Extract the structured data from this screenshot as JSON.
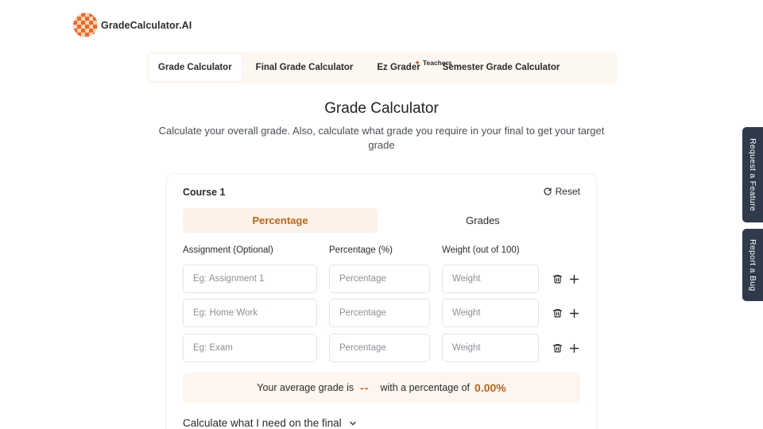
{
  "brand": {
    "name": "GradeCalculator.AI",
    "colors": {
      "accent": "#b8651e",
      "accent_bg": "#fdf2e8",
      "sidebar_tab": "#2f3a4a"
    }
  },
  "nav": {
    "items": [
      {
        "label": "Grade Calculator",
        "active": true
      },
      {
        "label": "Final Grade Calculator",
        "active": false
      },
      {
        "label": "Ez Grader",
        "active": false,
        "badge": "Teachers",
        "badge_icon": "sparkle-icon"
      },
      {
        "label": "Semester Grade Calculator",
        "active": false
      }
    ]
  },
  "header": {
    "title": "Grade Calculator",
    "subtitle": "Calculate your overall grade. Also, calculate what grade you require in your final to get your target grade"
  },
  "course": {
    "title": "Course 1",
    "reset_label": "Reset",
    "reset_icon": "refresh-icon",
    "mode_tabs": [
      {
        "label": "Percentage",
        "active": true
      },
      {
        "label": "Grades",
        "active": false
      }
    ],
    "columns": {
      "assignment": "Assignment (Optional)",
      "percentage": "Percentage (%)",
      "weight": "Weight (out of 100)"
    },
    "rows": [
      {
        "assignment_placeholder": "Eg: Assignment 1",
        "assignment_value": "",
        "percentage_placeholder": "Percentage",
        "percentage_value": "",
        "weight_placeholder": "Weight",
        "weight_value": ""
      },
      {
        "assignment_placeholder": "Eg: Home Work",
        "assignment_value": "",
        "percentage_placeholder": "Percentage",
        "percentage_value": "",
        "weight_placeholder": "Weight",
        "weight_value": ""
      },
      {
        "assignment_placeholder": "Eg: Exam",
        "assignment_value": "",
        "percentage_placeholder": "Percentage",
        "percentage_value": "",
        "weight_placeholder": "Weight",
        "weight_value": ""
      }
    ],
    "row_icons": [
      "trash-icon",
      "plus-icon"
    ],
    "result": {
      "prefix": "Your average grade is",
      "grade": "--",
      "middle": "with a percentage of",
      "percentage": "0.00%"
    },
    "final_toggle": {
      "label": "Calculate what I need on the final",
      "icon": "chevron-down-icon"
    }
  },
  "side_tabs": [
    {
      "label": "Request a Feature"
    },
    {
      "label": "Report a Bug"
    }
  ]
}
